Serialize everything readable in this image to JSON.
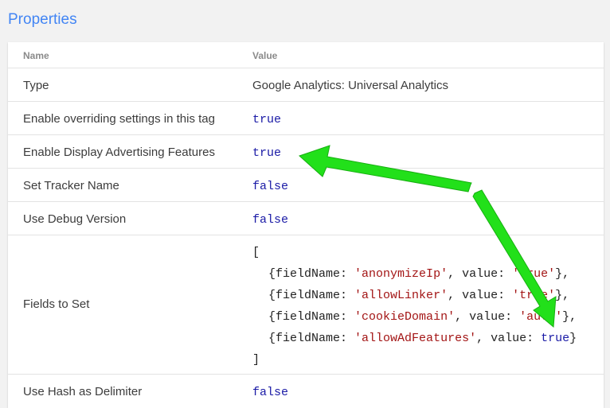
{
  "section": {
    "title": "Properties"
  },
  "table": {
    "header": {
      "name": "Name",
      "value": "Value"
    },
    "rows": [
      {
        "name": "Type",
        "value": "Google Analytics: Universal Analytics"
      },
      {
        "name": "Enable overriding settings in this tag",
        "value": "true"
      },
      {
        "name": "Enable Display Advertising Features",
        "value": "true"
      },
      {
        "name": "Set Tracker Name",
        "value": "false"
      },
      {
        "name": "Use Debug Version",
        "value": "false"
      },
      {
        "name": "Fields to Set",
        "value": ""
      },
      {
        "name": "Use Hash as Delimiter",
        "value": "false"
      }
    ],
    "fields": {
      "open": "[",
      "close": "]",
      "key_label": "fieldName: ",
      "value_label": ", value: ",
      "items": [
        {
          "field": "'anonymizeIp'",
          "value": "'true'",
          "sep": "},"
        },
        {
          "field": "'allowLinker'",
          "value": "'true'",
          "sep": "},"
        },
        {
          "field": "'cookieDomain'",
          "value": "'auto'",
          "sep": "},"
        },
        {
          "field": "'allowAdFeatures'",
          "value": "true",
          "sep": "}"
        }
      ]
    }
  },
  "colors": {
    "arrow": "#22e01a",
    "title": "#4285f4"
  }
}
